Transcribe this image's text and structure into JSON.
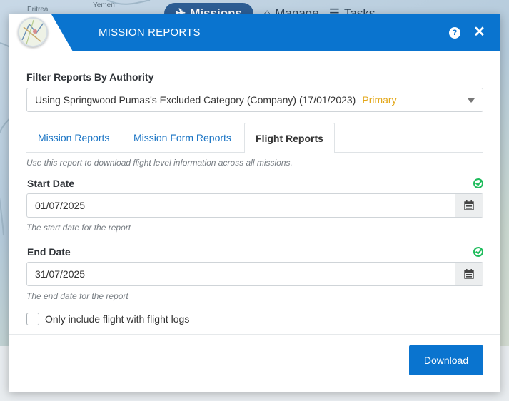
{
  "background": {
    "nav": {
      "missions": "Missions",
      "manage": "Manage",
      "tasks": "Tasks"
    },
    "map_labels": [
      "Eritrea",
      "Yemen"
    ]
  },
  "dialog": {
    "title": "MISSION REPORTS",
    "help_icon": "?",
    "close_icon": "✕",
    "filter_label": "Filter Reports By Authority",
    "filter_value": "Using Springwood Pumas's Excluded Category (Company) (17/01/2023)",
    "filter_badge": "Primary",
    "tabs": [
      {
        "label": "Mission Reports",
        "active": false
      },
      {
        "label": "Mission Form Reports",
        "active": false
      },
      {
        "label": "Flight Reports",
        "active": true
      }
    ],
    "description": "Use this report to download flight level information across all missions.",
    "start_date": {
      "label": "Start Date",
      "value": "01/07/2025",
      "hint": "The start date for the report"
    },
    "end_date": {
      "label": "End Date",
      "value": "31/07/2025",
      "hint": "The end date for the report"
    },
    "flight_logs_checkbox": {
      "label": "Only include flight with flight logs",
      "checked": false
    },
    "download_label": "Download"
  },
  "colors": {
    "accent": "#0a74cf",
    "primary_badge": "#e3a718",
    "valid": "#1fbc5c"
  }
}
